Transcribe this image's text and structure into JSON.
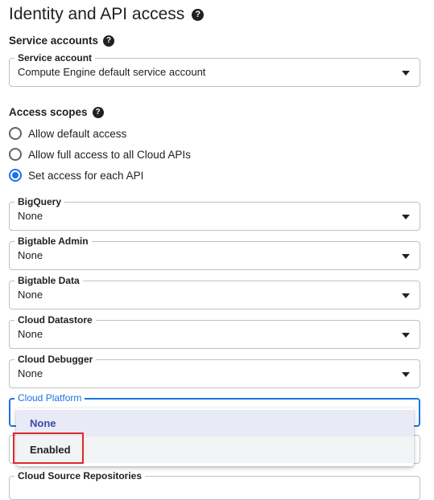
{
  "header": {
    "title": "Identity and API access"
  },
  "service_accounts": {
    "heading": "Service accounts",
    "field_label": "Service account",
    "field_value": "Compute Engine default service account"
  },
  "access_scopes": {
    "heading": "Access scopes",
    "options": [
      {
        "label": "Allow default access",
        "checked": false
      },
      {
        "label": "Allow full access to all Cloud APIs",
        "checked": false
      },
      {
        "label": "Set access for each API",
        "checked": true
      }
    ]
  },
  "api_fields": [
    {
      "label": "BigQuery",
      "value": "None"
    },
    {
      "label": "Bigtable Admin",
      "value": "None"
    },
    {
      "label": "Bigtable Data",
      "value": "None"
    },
    {
      "label": "Cloud Datastore",
      "value": "None"
    },
    {
      "label": "Cloud Debugger",
      "value": "None"
    }
  ],
  "cloud_platform": {
    "label": "Cloud Platform",
    "options": [
      "None",
      "Enabled"
    ],
    "highlighted_option": "None",
    "annotated_option": "Enabled"
  },
  "next_field": {
    "label": "Cloud Source Repositories"
  },
  "colors": {
    "accent": "#1a73e8",
    "annotation": "#e0272c",
    "selected_option_bg": "#e8eaf6"
  }
}
